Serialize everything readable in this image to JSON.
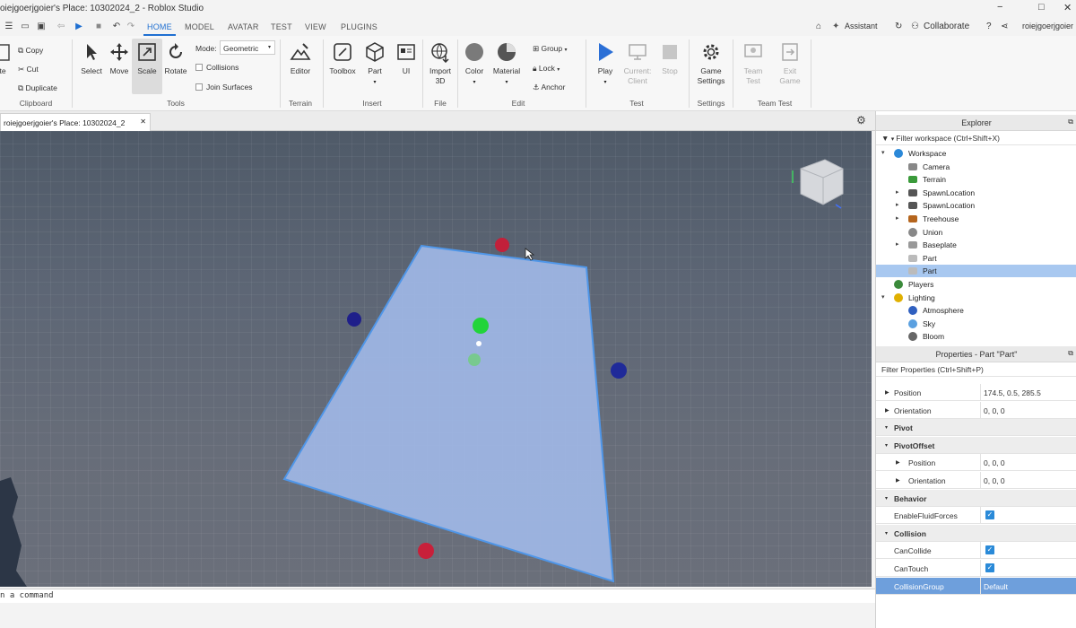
{
  "window": {
    "title": "oiejgoerjgoier's Place: 10302024_2 - Roblox Studio",
    "controls": [
      "−",
      "□",
      "✕"
    ]
  },
  "menu": {
    "tabs": [
      "HOME",
      "MODEL",
      "AVATAR",
      "TEST",
      "VIEW",
      "PLUGINS"
    ],
    "active": "HOME",
    "right": {
      "assistant": "Assistant",
      "collaborate": "Collaborate",
      "user": "roiejgoerjgoier"
    }
  },
  "ribbon": {
    "clipboard": {
      "paste": "te",
      "copy": "Copy",
      "cut": "Cut",
      "duplicate": "Duplicate",
      "group": "Clipboard"
    },
    "tools": {
      "select": "Select",
      "move": "Move",
      "scale": "Scale",
      "rotate": "Rotate",
      "mode_label": "Mode:",
      "mode_value": "Geometric",
      "collisions": "Collisions",
      "join_surfaces": "Join Surfaces",
      "group": "Tools"
    },
    "terrain": {
      "editor": "Editor",
      "group": "Terrain"
    },
    "insert": {
      "toolbox": "Toolbox",
      "part": "Part",
      "ui": "UI",
      "group": "Insert"
    },
    "file": {
      "import": "Import\n3D",
      "import_line1": "Import",
      "import_line2": "3D",
      "group": "File"
    },
    "edit": {
      "color": "Color",
      "material": "Material",
      "group_btn": "Group",
      "lock": "Lock",
      "anchor": "Anchor",
      "group": "Edit"
    },
    "test": {
      "play": "Play",
      "current_client_1": "Current:",
      "current_client_2": "Client",
      "stop": "Stop",
      "group": "Test"
    },
    "settings": {
      "game_1": "Game",
      "game_2": "Settings",
      "group": "Settings"
    },
    "team_test": {
      "team_1": "Team",
      "team_2": "Test",
      "exit_1": "Exit",
      "exit_2": "Game",
      "group": "Team Test"
    }
  },
  "document_tab": "roiejgoerjgoier's Place: 10302024_2",
  "command_bar": "n a command",
  "explorer": {
    "title": "Explorer",
    "filter": "Filter workspace (Ctrl+Shift+X)",
    "items": [
      {
        "label": "Workspace",
        "icon": "globe-icon"
      },
      {
        "label": "Camera",
        "icon": "camera-icon"
      },
      {
        "label": "Terrain",
        "icon": "terrain-icon"
      },
      {
        "label": "SpawnLocation",
        "icon": "spawn-icon"
      },
      {
        "label": "SpawnLocation",
        "icon": "spawn-icon"
      },
      {
        "label": "Treehouse",
        "icon": "model-icon"
      },
      {
        "label": "Union",
        "icon": "union-icon"
      },
      {
        "label": "Baseplate",
        "icon": "part-icon"
      },
      {
        "label": "Part",
        "icon": "part-icon"
      },
      {
        "label": "Part",
        "icon": "part-icon"
      },
      {
        "label": "Players",
        "icon": "players-icon"
      },
      {
        "label": "Lighting",
        "icon": "lightbulb-icon"
      },
      {
        "label": "Atmosphere",
        "icon": "atmosphere-icon"
      },
      {
        "label": "Sky",
        "icon": "sky-icon"
      },
      {
        "label": "Bloom",
        "icon": "bloom-icon"
      }
    ]
  },
  "properties": {
    "title": "Properties - Part \"Part\"",
    "filter": "Filter Properties (Ctrl+Shift+P)",
    "rows": [
      {
        "name": "Position",
        "value": "174.5, 0.5, 285.5"
      },
      {
        "name": "Orientation",
        "value": "0, 0, 0"
      },
      {
        "name": "Pivot",
        "value": ""
      },
      {
        "name": "PivotOffset",
        "value": ""
      },
      {
        "name": "Position",
        "value": "0, 0, 0"
      },
      {
        "name": "Orientation",
        "value": "0, 0, 0"
      },
      {
        "name": "Behavior",
        "value": ""
      },
      {
        "name": "EnableFluidForces",
        "value": "true"
      },
      {
        "name": "Collision",
        "value": ""
      },
      {
        "name": "CanCollide",
        "value": "true"
      },
      {
        "name": "CanTouch",
        "value": "true"
      },
      {
        "name": "CollisionGroup",
        "value": "Default"
      }
    ]
  }
}
